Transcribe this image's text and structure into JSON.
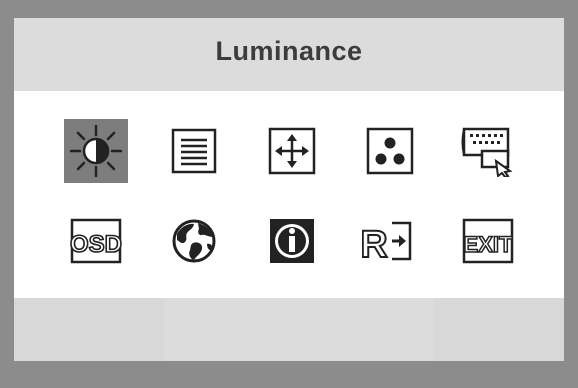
{
  "menu": {
    "title": "Luminance",
    "selected_item": "luminance",
    "items": [
      {
        "id": "luminance",
        "icon": "brightness-icon"
      },
      {
        "id": "image-setup",
        "icon": "lines-icon"
      },
      {
        "id": "position",
        "icon": "move-arrows-icon"
      },
      {
        "id": "color",
        "icon": "color-dots-icon"
      },
      {
        "id": "input-select",
        "icon": "monitor-connector-icon"
      },
      {
        "id": "osd-setup",
        "icon": "osd-icon"
      },
      {
        "id": "language",
        "icon": "globe-icon"
      },
      {
        "id": "information",
        "icon": "info-icon"
      },
      {
        "id": "reset",
        "icon": "reset-icon"
      },
      {
        "id": "exit",
        "icon": "exit-icon"
      }
    ]
  },
  "icon_text": {
    "osd": "OSD",
    "reset": "R",
    "exit": "EXIT"
  },
  "colors": {
    "frame": "#8c8c8c",
    "title_bar": "#dcdcdc",
    "selected_bg": "#7d7d7d",
    "icon_ink": "#222222"
  }
}
